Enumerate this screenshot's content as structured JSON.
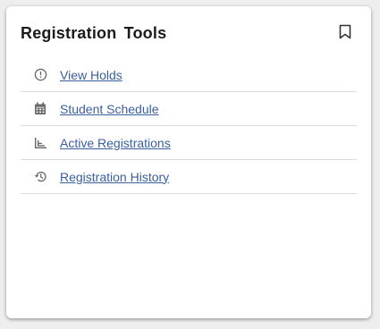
{
  "card": {
    "title": "Registration Tools",
    "bookmark_icon": "bookmark-outline-icon"
  },
  "tools": [
    {
      "label": "View Holds",
      "icon": "alert-circle-icon"
    },
    {
      "label": "Student Schedule",
      "icon": "calendar-icon"
    },
    {
      "label": "Active Registrations",
      "icon": "bar-chart-icon"
    },
    {
      "label": "Registration History",
      "icon": "history-icon"
    }
  ],
  "colors": {
    "link": "#3a5f9c",
    "title": "#1b1b1b",
    "icon": "#666666",
    "divider": "#dcdcdc"
  }
}
